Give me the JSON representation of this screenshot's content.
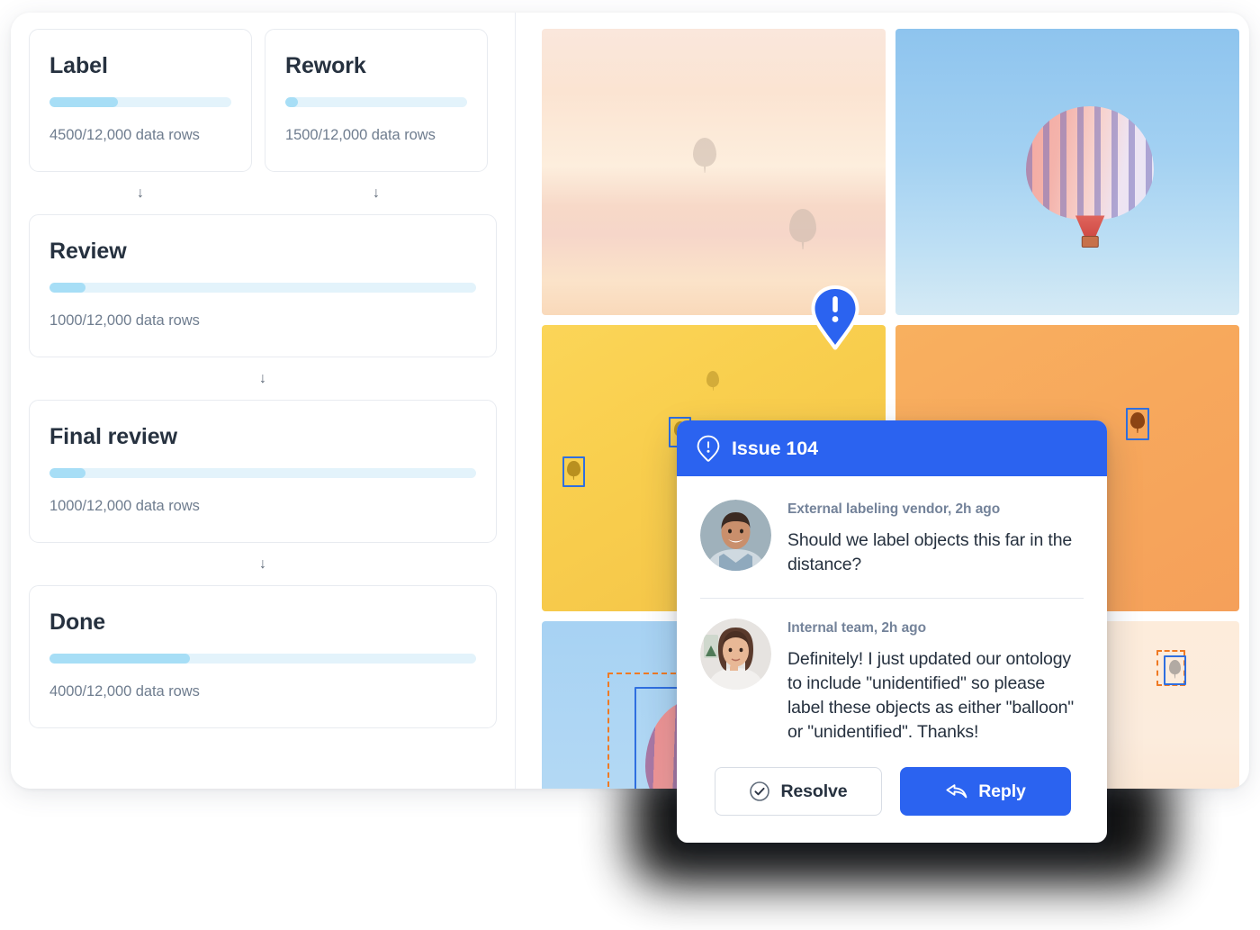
{
  "pipeline": {
    "stages": [
      {
        "title": "Label",
        "meta": "4500/12,000 data rows",
        "percent": 37.5,
        "layout": "half"
      },
      {
        "title": "Rework",
        "meta": "1500/12,000 data rows",
        "percent": 7,
        "layout": "half"
      },
      {
        "title": "Review",
        "meta": "1000/12,000 data rows",
        "percent": 8.5,
        "layout": "full"
      },
      {
        "title": "Final review",
        "meta": "1000/12,000 data rows",
        "percent": 8.5,
        "layout": "full"
      },
      {
        "title": "Done",
        "meta": "4000/12,000 data rows",
        "percent": 33,
        "layout": "full"
      }
    ],
    "arrow_glyph": "↓"
  },
  "gallery": {
    "tiles": [
      {
        "id": "tile-1",
        "caption": "hazy sunset sky with distant balloons"
      },
      {
        "id": "tile-2",
        "caption": "blue sky with striped hot air balloon"
      },
      {
        "id": "tile-3",
        "caption": "golden sky with annotated balloons"
      },
      {
        "id": "tile-4",
        "caption": "orange sky with annotated balloon"
      },
      {
        "id": "tile-5",
        "caption": "blue sky with pink balloon and annotations"
      },
      {
        "id": "tile-6",
        "caption": "cream sky with two annotated balloons"
      }
    ]
  },
  "issue_marker": {
    "icon": "warning-pin-icon",
    "color": "#2b63f0"
  },
  "issue_dialog": {
    "title": "Issue 104",
    "header_icon": "warning-pin-icon",
    "header_color": "#2b63f0",
    "comments": [
      {
        "meta": "External labeling vendor, 2h ago",
        "text": "Should we label objects this far in the distance?",
        "avatar": "male-avatar"
      },
      {
        "meta": "Internal team, 2h ago",
        "text": "Definitely! I just updated our ontology to include \"unidentified\" so please label these objects as either \"balloon\" or \"unidentified\". Thanks!",
        "avatar": "female-avatar"
      }
    ],
    "actions": {
      "resolve_label": "Resolve",
      "resolve_icon": "check-circle-icon",
      "reply_label": "Reply",
      "reply_icon": "reply-arrow-icon"
    }
  },
  "colors": {
    "accent_blue": "#2b63f0",
    "progress_fill": "#a7def6",
    "progress_track": "#e3f3fb",
    "bbox_blue": "#2f6fe0",
    "bbox_orange": "#ef7a24",
    "text_dark": "#26313f",
    "text_muted": "#6f7d8f"
  }
}
